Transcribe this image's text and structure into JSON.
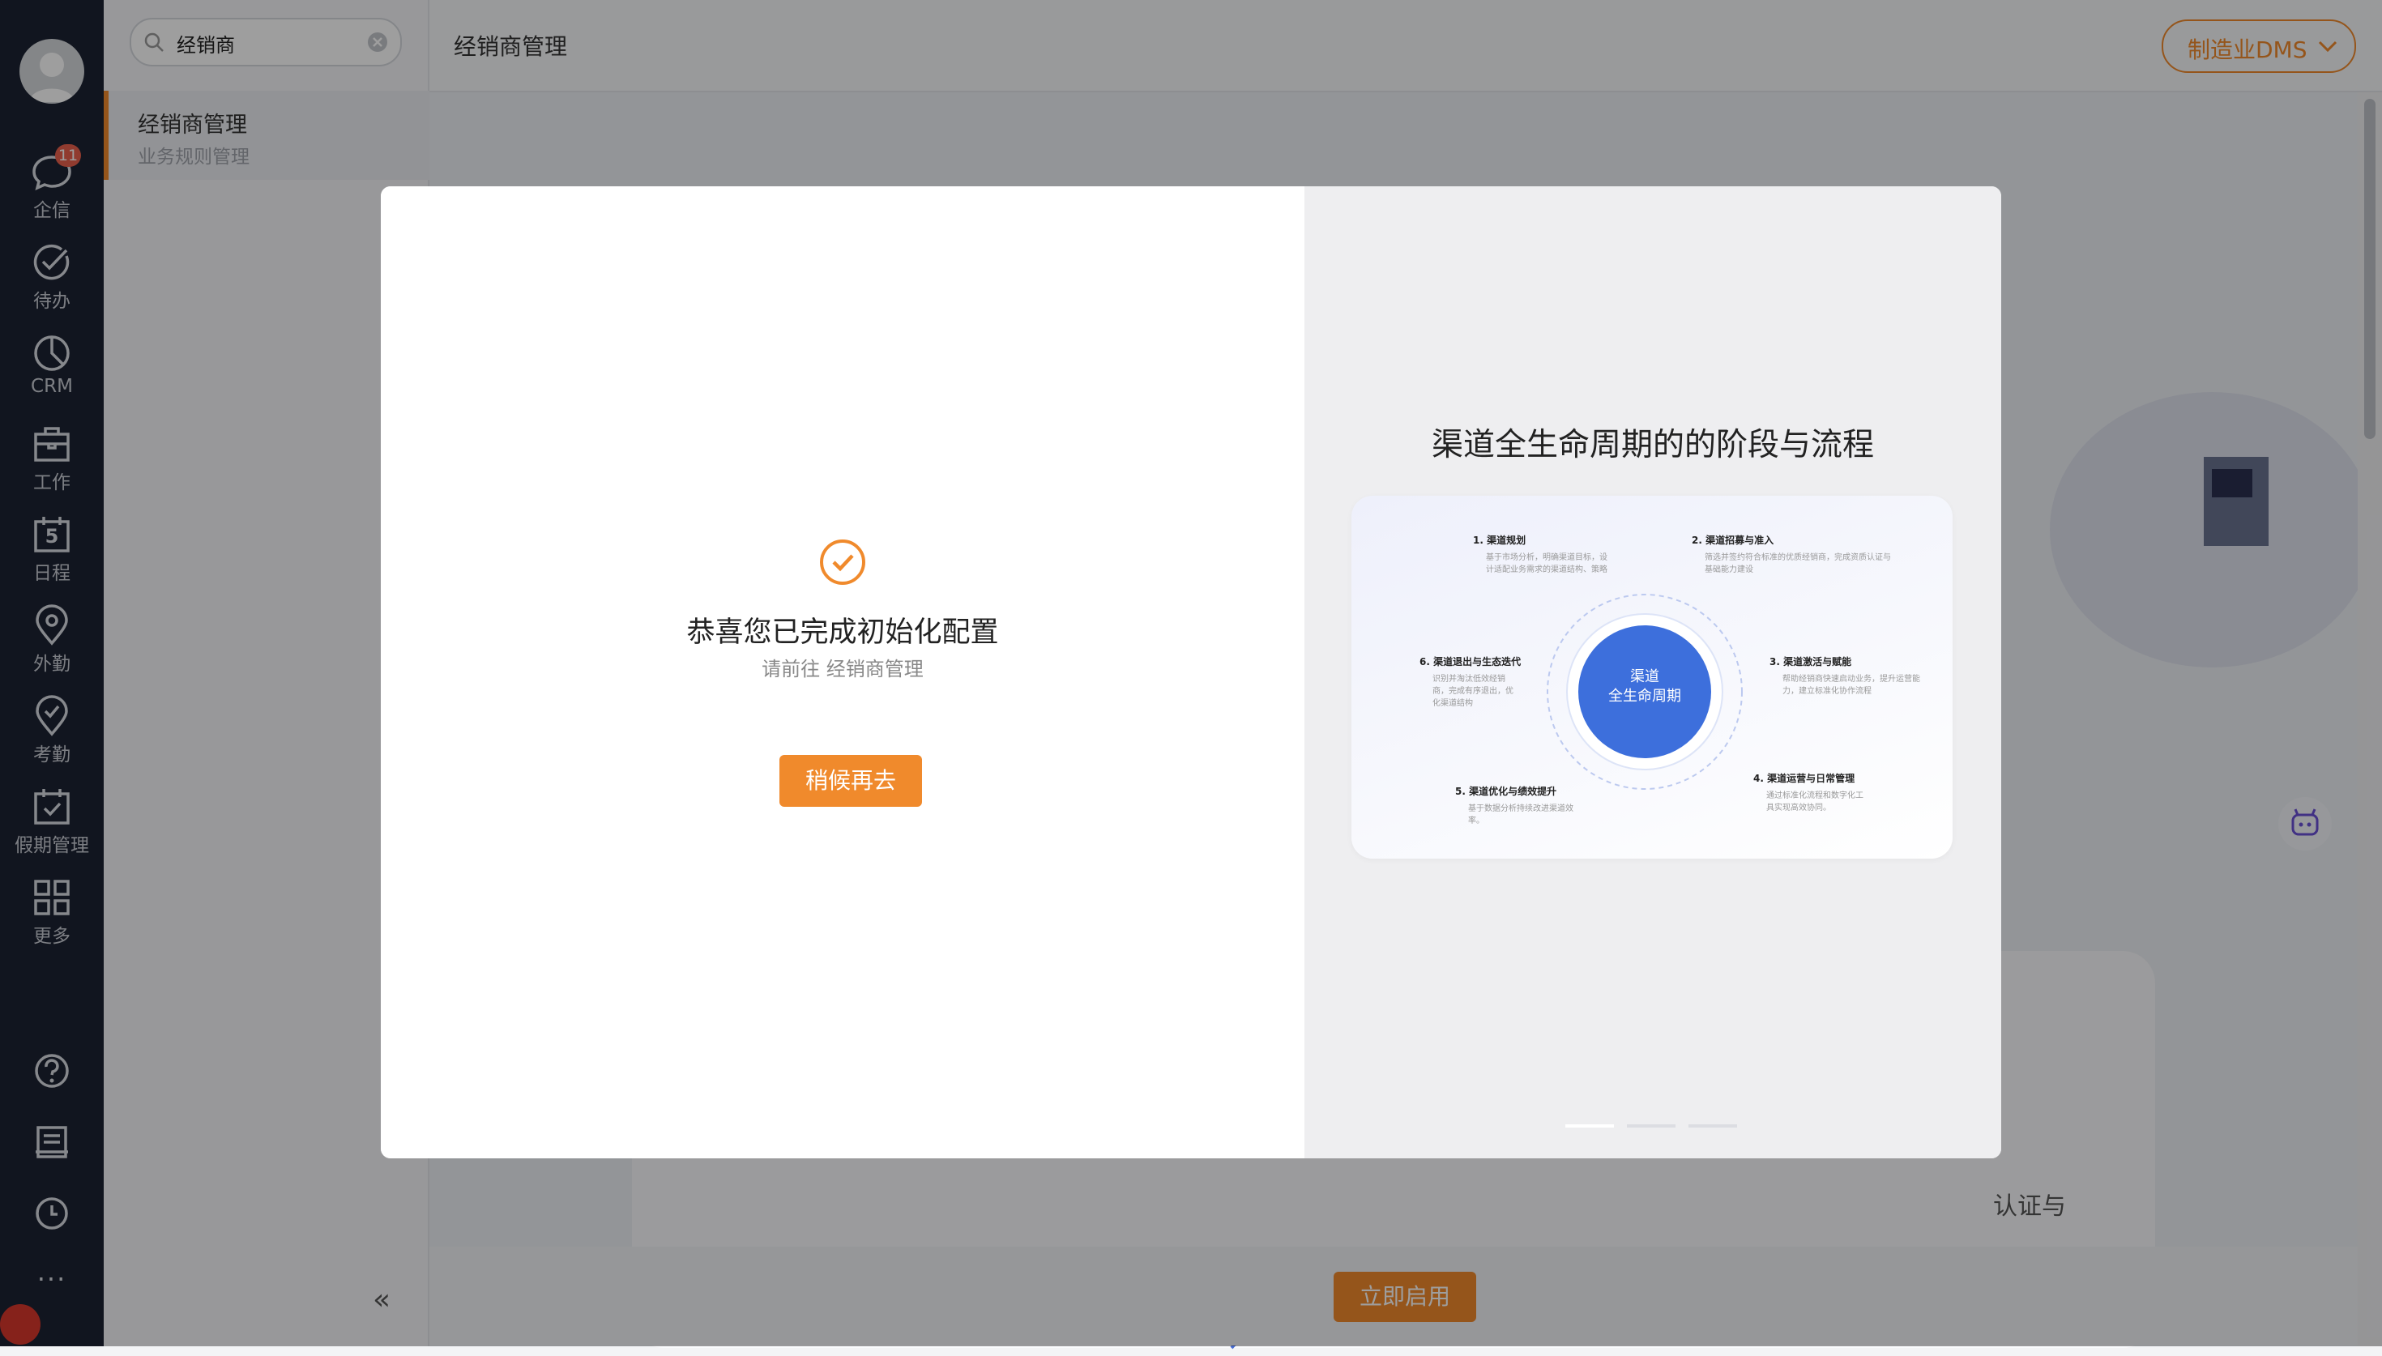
{
  "rail": {
    "items": [
      {
        "label": "企信",
        "badge": "11"
      },
      {
        "label": "待办"
      },
      {
        "label": "CRM"
      },
      {
        "label": "工作"
      },
      {
        "label": "日程",
        "day": "5"
      },
      {
        "label": "外勤"
      },
      {
        "label": "考勤"
      },
      {
        "label": "假期管理"
      },
      {
        "label": "更多"
      }
    ],
    "more_dots": "···"
  },
  "sidebar": {
    "search": {
      "value": "经销商"
    },
    "items": [
      {
        "label": "经销商管理",
        "sub": "业务规则管理"
      }
    ],
    "collapse_glyph": "«"
  },
  "header": {
    "title": "经销商管理",
    "app_switch": "制造业DMS"
  },
  "background": {
    "partial_text": "认证与",
    "enable_button": "立即启用"
  },
  "modal": {
    "title": "恭喜您已完成初始化配置",
    "subtitle": "请前往 经销商管理",
    "later_button": "稍候再去",
    "right_title": "渠道全生命周期的的阶段与流程",
    "center_line1": "渠道",
    "center_line2": "全生命周期",
    "stages": [
      {
        "title": "1. 渠道规划",
        "desc1": "基于市场分析，明确渠道目标，设",
        "desc2": "计适配业务需求的渠道结构、策略"
      },
      {
        "title": "2. 渠道招募与准入",
        "desc1": "筛选并签约符合标准的优质经销商，完成资质认证与",
        "desc2": "基础能力建设"
      },
      {
        "title": "3. 渠道激活与赋能",
        "desc1": "帮助经销商快速启动业务，提升运营能",
        "desc2": "力，建立标准化协作流程"
      },
      {
        "title": "4. 渠道运营与日常管理",
        "desc1": "通过标准化流程和数字化工",
        "desc2": "具实现高效协同。"
      },
      {
        "title": "5. 渠道优化与绩效提升",
        "desc1": "基于数据分析持续改进渠道效",
        "desc2": "率。"
      },
      {
        "title": "6. 渠道退出与生态迭代",
        "desc1": "识别并淘汰低效经销",
        "desc2": "商，完成有序退出，优",
        "desc3": "化渠道结构"
      }
    ],
    "carousel_active": 1,
    "carousel_total": 3
  },
  "colors": {
    "rail_bg": "#1c2232",
    "accent": "#f08a2c",
    "center_blue": "#3d6fdc"
  }
}
